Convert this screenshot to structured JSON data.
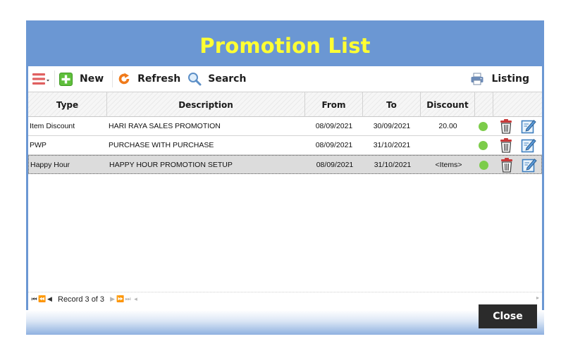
{
  "window": {
    "title": "Promotion List",
    "title_color": "#ffff33",
    "frame_color": "#6b97d3"
  },
  "toolbar": {
    "menu_icon": "list-menu-icon",
    "new_label": "New",
    "new_icon": "plus-icon",
    "refresh_label": "Refresh",
    "refresh_icon": "refresh-icon",
    "search_label": "Search",
    "search_icon": "magnifier-icon",
    "listing_label": "Listing",
    "listing_icon": "printer-icon"
  },
  "grid": {
    "columns": [
      "Type",
      "Description",
      "From",
      "To",
      "Discount",
      "",
      ""
    ],
    "rows": [
      {
        "type": "Item Discount",
        "description": "HARI RAYA SALES PROMOTION",
        "from": "08/09/2021",
        "to": "30/09/2021",
        "discount": "20.00",
        "status_color": "#7ccc4a",
        "selected": false
      },
      {
        "type": "PWP",
        "description": "PURCHASE WITH PURCHASE",
        "from": "08/09/2021",
        "to": "31/10/2021",
        "discount": "",
        "status_color": "#7ccc4a",
        "selected": false
      },
      {
        "type": "Happy Hour",
        "description": "HAPPY HOUR PROMOTION SETUP",
        "from": "08/09/2021",
        "to": "31/10/2021",
        "discount": "<Items>",
        "status_color": "#7ccc4a",
        "selected": true
      }
    ]
  },
  "pager": {
    "record_text": "Record 3 of 3"
  },
  "footer": {
    "close_label": "Close"
  }
}
